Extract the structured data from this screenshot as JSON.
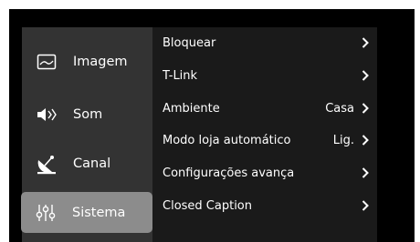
{
  "colors": {
    "screen_bg": "#000000",
    "sidebar_bg": "#333333",
    "selected_bg": "#8c8c8c",
    "panel_bg": "#1a1a1a",
    "text": "#ffffff"
  },
  "sidebar": {
    "items": [
      {
        "label": "Imagem",
        "icon": "image-icon",
        "selected": false
      },
      {
        "label": "Som",
        "icon": "speaker-icon",
        "selected": false
      },
      {
        "label": "Canal",
        "icon": "satellite-dish-icon",
        "selected": false
      },
      {
        "label": "Sistema",
        "icon": "sliders-icon",
        "selected": true
      }
    ]
  },
  "menu": {
    "items": [
      {
        "label": "Bloquear",
        "value": "",
        "icon": "chevron-right-icon"
      },
      {
        "label": "T-Link",
        "value": "",
        "icon": "chevron-right-icon"
      },
      {
        "label": "Ambiente",
        "value": "Casa",
        "icon": "chevron-right-icon"
      },
      {
        "label": "Modo loja automático",
        "value": "Lig.",
        "icon": "chevron-right-icon"
      },
      {
        "label": "Configurações avança",
        "value": "",
        "icon": "chevron-right-icon"
      },
      {
        "label": "Closed Caption",
        "value": "",
        "icon": "chevron-right-icon"
      }
    ]
  }
}
